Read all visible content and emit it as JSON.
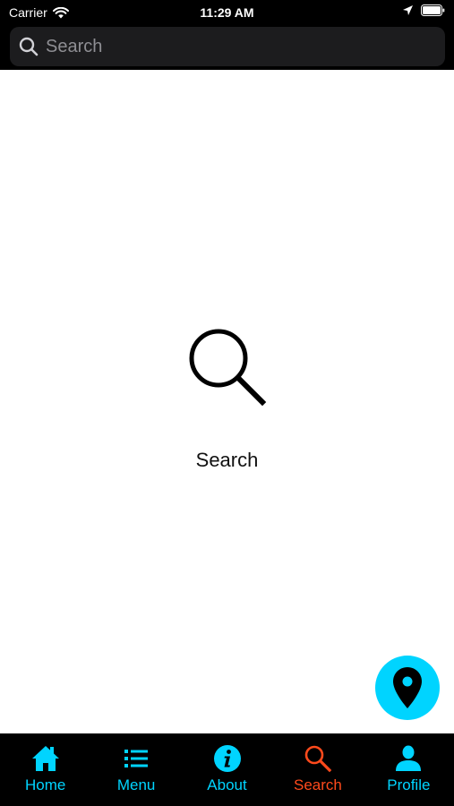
{
  "status_bar": {
    "carrier": "Carrier",
    "time": "11:29 AM",
    "icons": [
      "wifi-icon",
      "location-arrow-icon",
      "battery-icon"
    ]
  },
  "search": {
    "placeholder": "Search",
    "value": ""
  },
  "empty_state": {
    "icon": "search-icon",
    "title": "Search"
  },
  "fab": {
    "icon": "map-pin-icon",
    "color": "#00d4ff"
  },
  "tab_bar": {
    "active_color": "#ff4a1c",
    "inactive_color": "#00d4ff",
    "items": [
      {
        "label": "Home",
        "icon": "home-icon",
        "active": false
      },
      {
        "label": "Menu",
        "icon": "list-icon",
        "active": false
      },
      {
        "label": "About",
        "icon": "info-icon",
        "active": false
      },
      {
        "label": "Search",
        "icon": "search-icon",
        "active": true
      },
      {
        "label": "Profile",
        "icon": "person-icon",
        "active": false
      }
    ]
  }
}
